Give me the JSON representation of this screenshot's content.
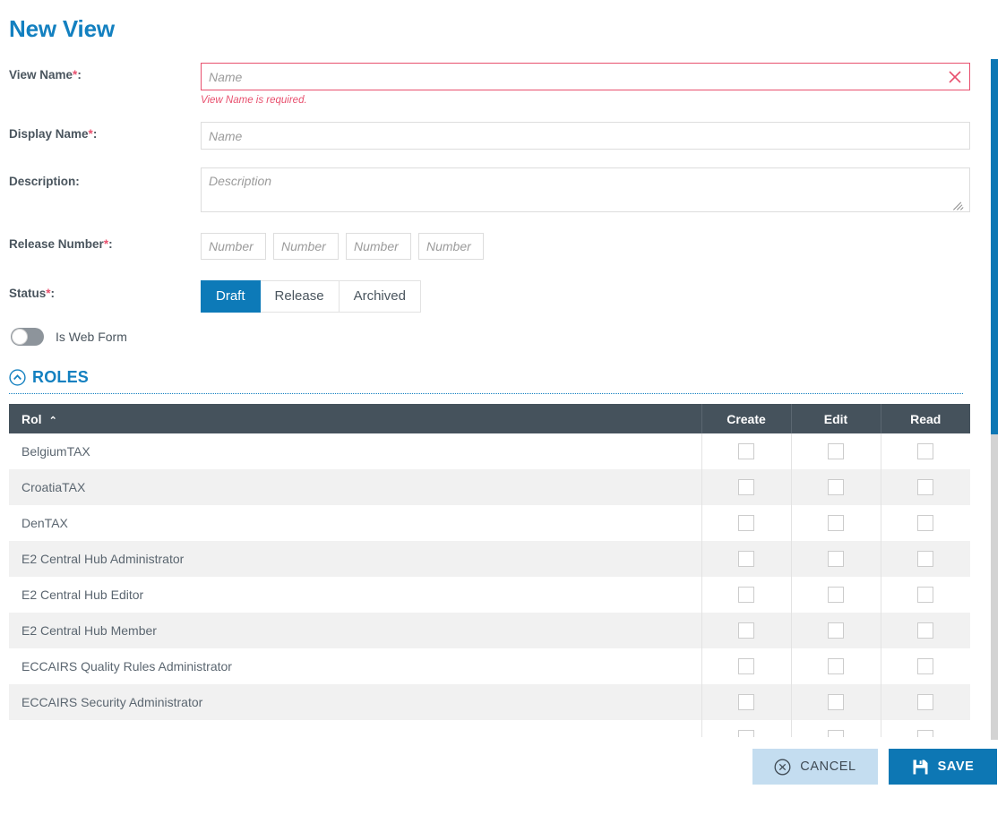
{
  "page": {
    "title": "New View"
  },
  "form": {
    "view_name": {
      "label": "View Name",
      "required_mark": "*",
      "colon": ":",
      "placeholder": "Name",
      "value": "",
      "error": "View Name is required.",
      "clear_icon": "close-x-icon"
    },
    "display_name": {
      "label": "Display Name",
      "required_mark": "*",
      "colon": ":",
      "placeholder": "Name",
      "value": ""
    },
    "description": {
      "label": "Description",
      "required_mark": "",
      "colon": ":",
      "placeholder": "Description",
      "value": ""
    },
    "release_number": {
      "label": "Release Number",
      "required_mark": "*",
      "colon": ":",
      "placeholders": [
        "Number",
        "Number",
        "Number",
        "Number"
      ],
      "values": [
        "",
        "",
        "",
        ""
      ]
    },
    "status": {
      "label": "Status",
      "required_mark": "*",
      "colon": ":",
      "options": [
        "Draft",
        "Release",
        "Archived"
      ],
      "selected": "Draft"
    },
    "is_web_form": {
      "label": "Is Web Form",
      "checked": false
    }
  },
  "roles_section": {
    "title": "ROLES",
    "collapse_icon": "chevron-up-circle-icon",
    "expanded": true,
    "table": {
      "columns": [
        "Rol",
        "Create",
        "Edit",
        "Read"
      ],
      "sort_column": "Rol",
      "sort_direction": "asc",
      "sort_icon": "⌃",
      "rows": [
        {
          "role": "BelgiumTAX",
          "create": false,
          "edit": false,
          "read": false
        },
        {
          "role": "CroatiaTAX",
          "create": false,
          "edit": false,
          "read": false
        },
        {
          "role": "DenTAX",
          "create": false,
          "edit": false,
          "read": false
        },
        {
          "role": "E2 Central Hub Administrator",
          "create": false,
          "edit": false,
          "read": false
        },
        {
          "role": "E2 Central Hub Editor",
          "create": false,
          "edit": false,
          "read": false
        },
        {
          "role": "E2 Central Hub Member",
          "create": false,
          "edit": false,
          "read": false
        },
        {
          "role": "ECCAIRS Quality Rules Administrator",
          "create": false,
          "edit": false,
          "read": false
        },
        {
          "role": "ECCAIRS Security Administrator",
          "create": false,
          "edit": false,
          "read": false
        },
        {
          "role": "",
          "create": false,
          "edit": false,
          "read": false
        }
      ]
    }
  },
  "footer": {
    "cancel_label": "CANCEL",
    "cancel_icon": "circle-x-icon",
    "save_label": "SAVE",
    "save_icon": "floppy-disk-icon"
  },
  "scrollbar": {
    "orientation": "vertical",
    "thumb_position_percent": 0
  },
  "colors": {
    "accent_blue": "#0d77b4",
    "title_blue": "#1380c0",
    "error_red": "#e8506e",
    "header_slate": "#45525c",
    "row_alt": "#f1f1f1",
    "cancel_bg": "#c4ddf0"
  }
}
